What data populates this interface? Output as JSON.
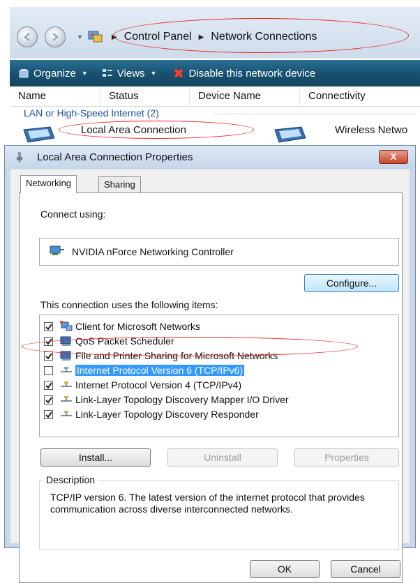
{
  "explorer": {
    "breadcrumb": [
      "Control Panel",
      "Network Connections"
    ],
    "toolbar": {
      "organize": "Organize",
      "views": "Views",
      "disable": "Disable this network device"
    },
    "columns": [
      "Name",
      "Status",
      "Device Name",
      "Connectivity"
    ],
    "group_label": "LAN or High-Speed Internet (2)",
    "connections": [
      "Local Area Connection",
      "Wireless Netwo"
    ]
  },
  "dialog": {
    "title": "Local Area Connection Properties",
    "close_label": "X",
    "tabs": [
      "Networking",
      "Sharing"
    ],
    "connect_using_label": "Connect using:",
    "adapter_name": "NVIDIA nForce Networking Controller",
    "configure_label": "Configure...",
    "items_label": "This connection uses the following items:",
    "items": [
      {
        "label": "Client for Microsoft Networks",
        "checked": true
      },
      {
        "label": "QoS Packet Scheduler",
        "checked": true
      },
      {
        "label": "File and Printer Sharing for Microsoft Networks",
        "checked": true
      },
      {
        "label": "Internet Protocol Version 6 (TCP/IPv6)",
        "checked": false,
        "selected": true
      },
      {
        "label": "Internet Protocol Version 4 (TCP/IPv4)",
        "checked": true
      },
      {
        "label": "Link-Layer Topology Discovery Mapper I/O Driver",
        "checked": true
      },
      {
        "label": "Link-Layer Topology Discovery Responder",
        "checked": true
      }
    ],
    "install_label": "Install...",
    "uninstall_label": "Uninstall",
    "properties_label": "Properties",
    "description_label": "Description",
    "description_text": "TCP/IP version 6. The latest version of the internet protocol that provides communication across diverse interconnected networks.",
    "ok_label": "OK",
    "cancel_label": "Cancel"
  },
  "colors": {
    "toolbar": "#17506f",
    "callout": "#e8231f",
    "selection": "#3399ff"
  }
}
